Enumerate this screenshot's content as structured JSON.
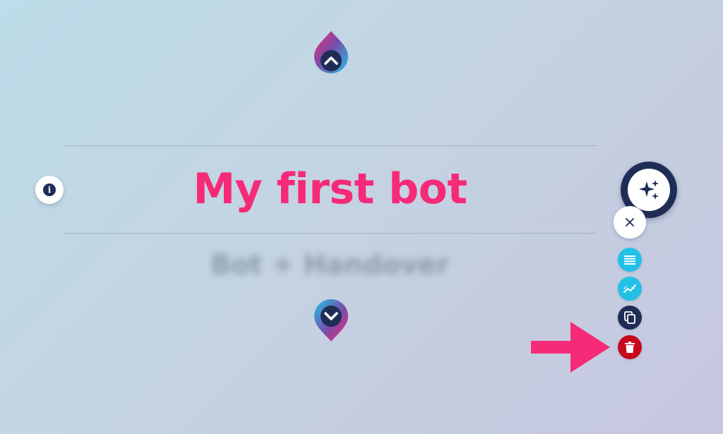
{
  "bot": {
    "title": "My first bot",
    "subtitle": "Bot + Handover"
  },
  "info_button": {
    "glyph": "i",
    "icon": "info-icon"
  },
  "navigation": {
    "up_icon": "chevron-up-pin-icon",
    "down_icon": "chevron-down-pin-icon"
  },
  "fab": {
    "main_icon": "sparkles-icon",
    "close_icon": "close-icon",
    "actions": [
      {
        "icon": "list-icon",
        "color": "#22c1e6"
      },
      {
        "icon": "stats-icon",
        "color": "#22c1e6"
      },
      {
        "icon": "copy-icon",
        "color": "#1f2d56"
      },
      {
        "icon": "trash-icon",
        "color": "#c6081d"
      }
    ]
  },
  "annotation": {
    "icon": "arrow-right-icon",
    "color": "#f72a77"
  },
  "colors": {
    "accent": "#f72a77",
    "navy": "#1f2d56",
    "cyan": "#22c1e6",
    "danger": "#c6081d"
  }
}
